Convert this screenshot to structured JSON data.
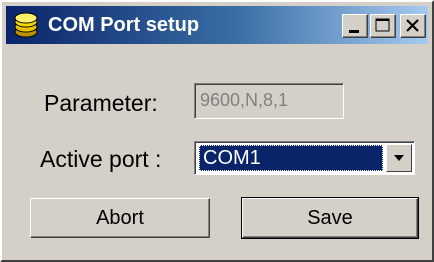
{
  "window": {
    "title": "COM Port setup",
    "icon": "database-stack-icon",
    "controls": {
      "minimize": "minimize-icon",
      "maximize": "maximize-icon",
      "close": "close-icon"
    }
  },
  "form": {
    "parameter_label": "Parameter:",
    "parameter_value": "9600,N,8,1",
    "active_port_label": "Active port :",
    "active_port_value": "COM1"
  },
  "buttons": {
    "abort_label": "Abort",
    "save_label": "Save"
  },
  "colors": {
    "titlebar_start": "#0a246a",
    "titlebar_end": "#a6caf0",
    "window_face": "#d4d0c8",
    "selection": "#0a246a"
  }
}
